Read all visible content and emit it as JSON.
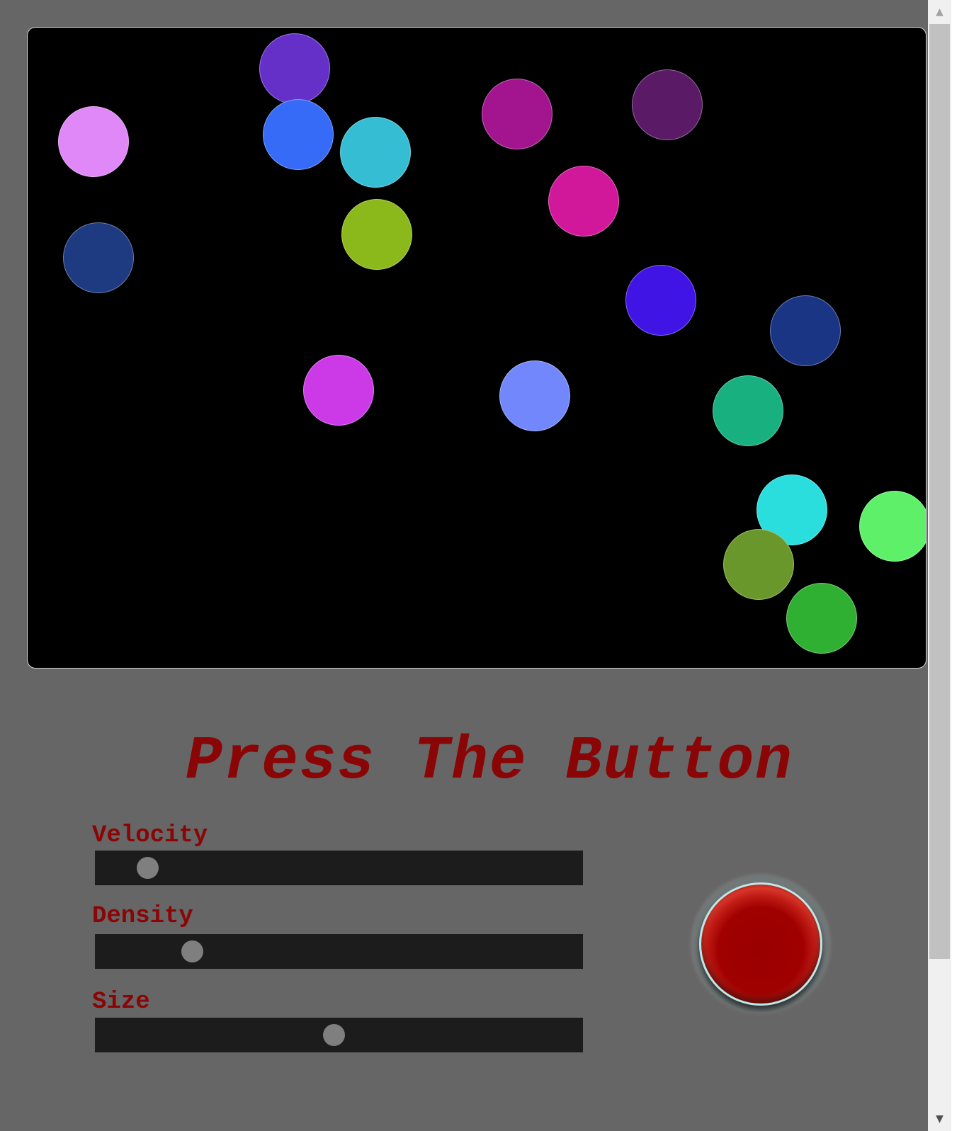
{
  "title": "Press The Button",
  "sliders": [
    {
      "label": "Velocity",
      "value": 0.09
    },
    {
      "label": "Density",
      "value": 0.185
    },
    {
      "label": "Size",
      "value": 0.49
    }
  ],
  "balls": [
    {
      "color": "#6530c8"
    },
    {
      "color": "#e088f7"
    },
    {
      "color": "#356bf7"
    },
    {
      "color": "#34bdd3"
    },
    {
      "color": "#a3148f"
    },
    {
      "color": "#5a1a66"
    },
    {
      "color": "#d1189a"
    },
    {
      "color": "#1e3a80"
    },
    {
      "color": "#8bb81a"
    },
    {
      "color": "#4114e6"
    },
    {
      "color": "#1b3585"
    },
    {
      "color": "#cc3ae8"
    },
    {
      "color": "#7287fb"
    },
    {
      "color": "#19b07f"
    },
    {
      "color": "#2adede"
    },
    {
      "color": "#5ff06a"
    },
    {
      "color": "#6a972b"
    },
    {
      "color": "#30b032"
    }
  ]
}
